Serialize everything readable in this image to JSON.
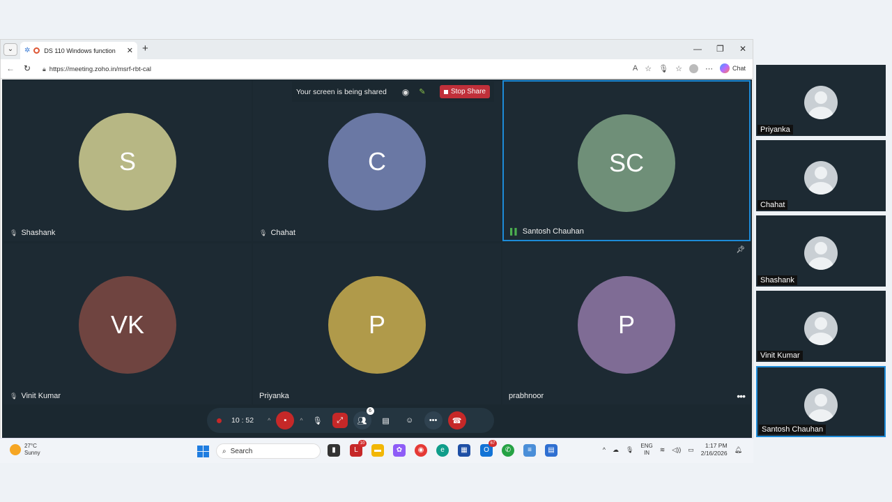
{
  "browser": {
    "tab_title": "DS 110 Windows function",
    "url": "https://meeting.zoho.in/msrf-rbt-cal",
    "chat_label": "Chat"
  },
  "share_banner": {
    "text": "Your screen is being shared",
    "stop_label": "Stop Share"
  },
  "tiles": [
    {
      "initials": "S",
      "name": "Shashank",
      "color": "#b7b784"
    },
    {
      "initials": "C",
      "name": "Chahat",
      "color": "#6a78a4"
    },
    {
      "initials": "SC",
      "name": "Santosh Chauhan",
      "color": "#6f8f78"
    },
    {
      "initials": "VK",
      "name": "Vinit Kumar",
      "color": "#6f4440"
    },
    {
      "initials": "P",
      "name": "Priyanka",
      "color": "#b09a4a"
    },
    {
      "initials": "P",
      "name": "prabhnoor",
      "color": "#7f6c95"
    }
  ],
  "controls": {
    "timer": "10 : 52",
    "participants_badge": "6"
  },
  "sidebar": [
    {
      "name": "Priyanka"
    },
    {
      "name": "Chahat"
    },
    {
      "name": "Shashank"
    },
    {
      "name": "Vinit Kumar"
    },
    {
      "name": "Santosh Chauhan"
    }
  ],
  "taskbar": {
    "temp": "27°C",
    "condition": "Sunny",
    "search_label": "Search",
    "badge_l": "10",
    "badge_outlook": "67",
    "lang_1": "ENG",
    "lang_2": "IN",
    "time": "1:17 PM",
    "date": "2/16/2026"
  }
}
